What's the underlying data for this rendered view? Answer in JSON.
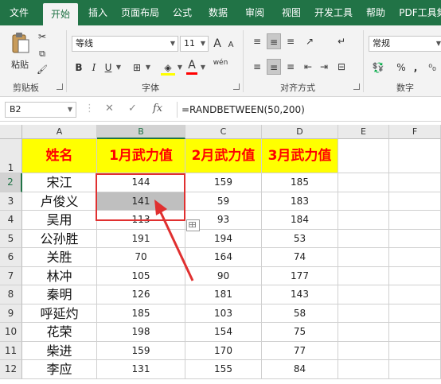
{
  "ribbon_tabs": [
    {
      "label": "文件"
    },
    {
      "label": "开始"
    },
    {
      "label": "插入"
    },
    {
      "label": "页面布局"
    },
    {
      "label": "公式"
    },
    {
      "label": "数据"
    },
    {
      "label": "审阅"
    },
    {
      "label": "视图"
    },
    {
      "label": "开发工具"
    },
    {
      "label": "帮助"
    },
    {
      "label": "PDF工具集"
    }
  ],
  "active_tab": "开始",
  "clipboard": {
    "paste_label": "粘贴",
    "group_label": "剪贴板"
  },
  "font": {
    "name": "等线",
    "size": "11",
    "group_label": "字体",
    "bold": "B",
    "italic": "I",
    "underline": "U",
    "grow": "A",
    "shrink": "A",
    "font_color": "A",
    "wen": "wén"
  },
  "alignment": {
    "group_label": "对齐方式"
  },
  "number": {
    "format": "常规",
    "group_label": "数字",
    "percent": "%",
    "comma": ","
  },
  "formula_bar": {
    "cell_ref": "B2",
    "formula": "=RANDBETWEEN(50,200)",
    "fx": "fx"
  },
  "columns": [
    "A",
    "B",
    "C",
    "D",
    "E",
    "F"
  ],
  "rows": [
    "1",
    "2",
    "3",
    "4",
    "5",
    "6",
    "7",
    "8",
    "9",
    "10",
    "11",
    "12"
  ],
  "table": {
    "headers": [
      "姓名",
      "1月武力值",
      "2月武力值",
      "3月武力值"
    ],
    "data": [
      [
        "宋江",
        "144",
        "159",
        "185"
      ],
      [
        "卢俊义",
        "141",
        "59",
        "183"
      ],
      [
        "吴用",
        "113",
        "93",
        "184"
      ],
      [
        "公孙胜",
        "191",
        "194",
        "53"
      ],
      [
        "关胜",
        "70",
        "164",
        "74"
      ],
      [
        "林冲",
        "105",
        "90",
        "177"
      ],
      [
        "秦明",
        "126",
        "181",
        "143"
      ],
      [
        "呼延灼",
        "185",
        "103",
        "58"
      ],
      [
        "花荣",
        "198",
        "154",
        "75"
      ],
      [
        "柴进",
        "159",
        "170",
        "77"
      ],
      [
        "李应",
        "131",
        "155",
        "84"
      ]
    ]
  },
  "colors": {
    "accent": "#217346",
    "header_fill": "#ffff00",
    "header_text": "#ff0000",
    "highlight": "#e03030"
  }
}
